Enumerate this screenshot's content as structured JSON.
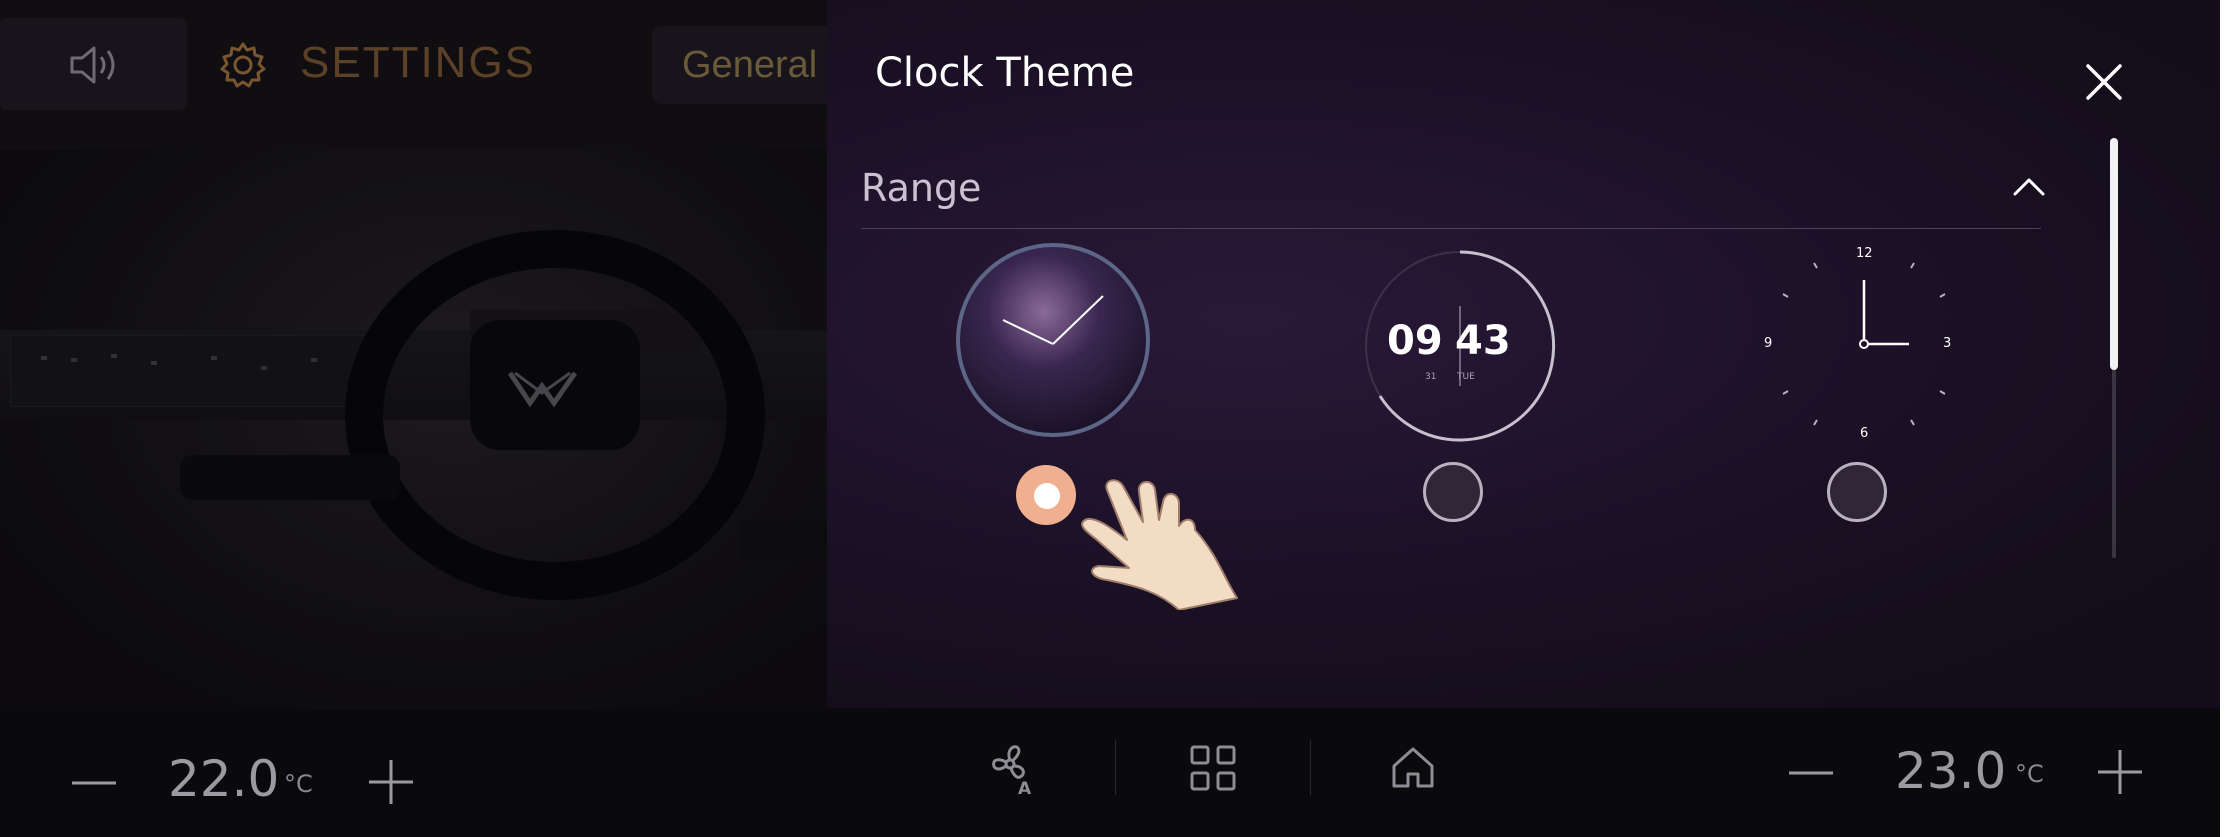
{
  "settings": {
    "title": "SETTINGS",
    "active_tab": "General"
  },
  "modal": {
    "title": "Clock Theme",
    "section_label": "Range",
    "themes": [
      {
        "style": "analog-glow",
        "selected": true
      },
      {
        "style": "digital",
        "hour": "09",
        "minute": "43",
        "date": "31",
        "day": "TUE",
        "selected": false
      },
      {
        "style": "analog-minimal",
        "numerals": [
          "12",
          "3",
          "6",
          "9"
        ],
        "selected": false
      }
    ]
  },
  "climate": {
    "left_temp": "22.0",
    "right_temp": "23.0",
    "unit": "°C"
  },
  "dock": {
    "icons": [
      "fan-auto-icon",
      "apps-grid-icon",
      "home-icon"
    ]
  },
  "colors": {
    "accent_orange": "#7a5630",
    "radio_selected": "#f0b090",
    "modal_bg": "#1c1127"
  }
}
